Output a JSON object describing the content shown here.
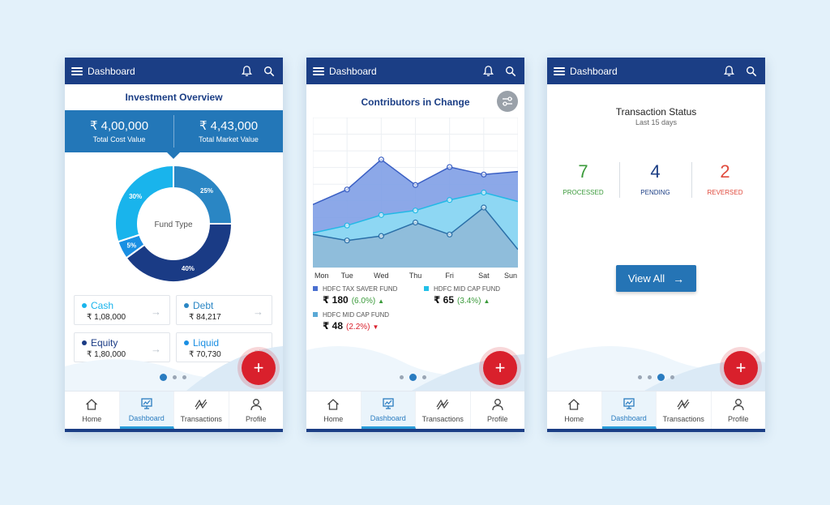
{
  "nav": {
    "title": "Dashboard",
    "items": [
      {
        "label": "Home",
        "icon": "home-icon"
      },
      {
        "label": "Dashboard",
        "icon": "dashboard-icon"
      },
      {
        "label": "Transactions",
        "icon": "transactions-icon"
      },
      {
        "label": "Profile",
        "icon": "profile-icon"
      }
    ],
    "fab": "+"
  },
  "overview": {
    "title": "Investment Overview",
    "total_cost": {
      "amount": "₹ 4,00,000",
      "label": "Total Cost Value"
    },
    "total_market": {
      "amount": "₹ 4,43,000",
      "label": "Total Market Value"
    },
    "donut_center": "Fund Type",
    "segments": [
      {
        "name": "Debt",
        "percent": 25,
        "label": "25%",
        "color": "#2a86c4"
      },
      {
        "name": "Equity",
        "percent": 40,
        "label": "40%",
        "color": "#1a3b85"
      },
      {
        "name": "Liquid",
        "percent": 5,
        "label": "5%",
        "color": "#1a8fe3"
      },
      {
        "name": "Cash",
        "percent": 30,
        "label": "30%",
        "color": "#19b4ec"
      }
    ],
    "cards": [
      {
        "name": "Cash",
        "value": "₹ 1,08,000",
        "color": "#19b4ec"
      },
      {
        "name": "Debt",
        "value": "₹ 84,217",
        "color": "#2a86c4"
      },
      {
        "name": "Equity",
        "value": "₹ 1,80,000",
        "color": "#1a3b85"
      },
      {
        "name": "Liquid",
        "value": "₹ 70,730",
        "color": "#1a8fe3"
      }
    ],
    "page_dots_active": 0
  },
  "contributors": {
    "title": "Contributors in Change",
    "legend": [
      {
        "fund": "HDFC TAX SAVER FUND",
        "value": "₹ 180",
        "change": "(6.0%)",
        "direction": "up",
        "color": "#4a6fd0"
      },
      {
        "fund": "HDFC MID CAP FUND",
        "value": "₹ 65",
        "change": "(3.4%)",
        "direction": "up",
        "color": "#22c0e8"
      },
      {
        "fund": "HDFC MID CAP FUND",
        "value": "₹ 48",
        "change": "(2.2%)",
        "direction": "down",
        "color": "#5aa9d6"
      }
    ],
    "page_dots_active": 1
  },
  "chart_data": {
    "type": "area",
    "x": [
      "Mon",
      "Tue",
      "Wed",
      "Thu",
      "Fri",
      "Sat",
      "Sun"
    ],
    "ylim": [
      0,
      100
    ],
    "series": [
      {
        "name": "HDFC TAX SAVER FUND",
        "values": [
          42,
          52,
          72,
          55,
          67,
          62,
          64
        ]
      },
      {
        "name": "HDFC MID CAP FUND",
        "values": [
          23,
          28,
          35,
          38,
          45,
          50,
          44
        ]
      },
      {
        "name": "HDFC MID CAP FUND",
        "values": [
          22,
          18,
          21,
          30,
          22,
          40,
          12
        ]
      }
    ]
  },
  "transactions": {
    "title": "Transaction Status",
    "subtitle": "Last 15 days",
    "stats": [
      {
        "count": "7",
        "label": "PROCESSED",
        "color": "#3a9a3a"
      },
      {
        "count": "4",
        "label": "PENDING",
        "color": "#1b3e85"
      },
      {
        "count": "2",
        "label": "REVERSED",
        "color": "#e04a3c"
      }
    ],
    "view_all": "View All",
    "page_dots_active": 2
  }
}
